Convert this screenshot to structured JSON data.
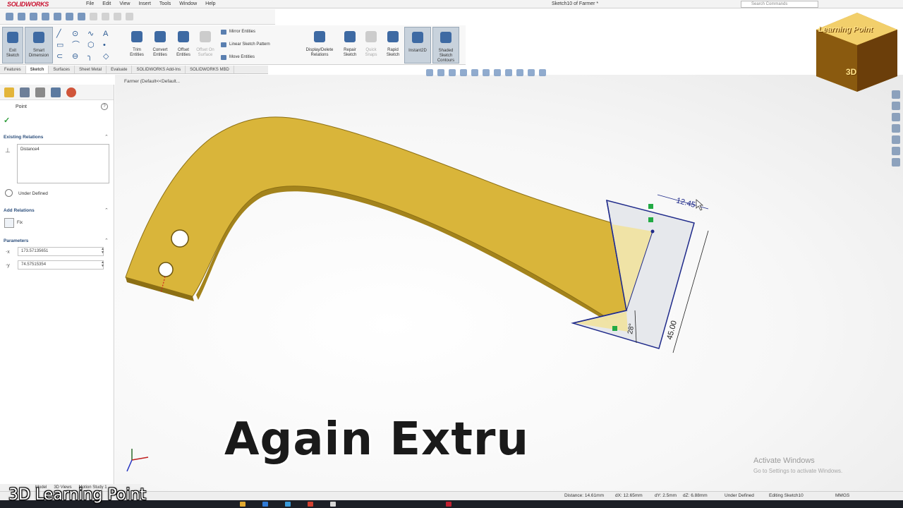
{
  "app": {
    "logo_text": "SOLIDWORKS",
    "document_title": "Sketch10 of Farmer *",
    "menu": [
      "File",
      "Edit",
      "View",
      "Insert",
      "Tools",
      "Window",
      "Help"
    ],
    "search_placeholder": "Search Commands"
  },
  "command_manager": {
    "exit_sketch": "Exit Sketch",
    "smart_dimension": "Smart Dimension",
    "trim_entities": "Trim Entities",
    "convert_entities": "Convert Entities",
    "offset_entities": "Offset Entities",
    "offset_on_surface": "Offset On Surface",
    "mirror_entities": "Mirror Entities",
    "linear_pattern": "Linear Sketch Pattern",
    "move_entities": "Move Entities",
    "display_relations": "Display/Delete Relations",
    "repair_sketch": "Repair Sketch",
    "quick_snaps": "Quick Snaps",
    "rapid_sketch": "Rapid Sketch",
    "instant2d": "Instant2D",
    "shaded_contours": "Shaded Sketch Contours"
  },
  "tabs": [
    "Features",
    "Sketch",
    "Surfaces",
    "Sheet Metal",
    "Evaluate",
    "SOLIDWORKS Add-Ins",
    "SOLIDWORKS MBD"
  ],
  "active_tab": "Sketch",
  "breadcrumb": "Farmer (Default<<Default...",
  "property_manager": {
    "title": "Point",
    "existing_relations_header": "Existing Relations",
    "relation_item": "Distance4",
    "status": "Under Defined",
    "add_relations_header": "Add Relations",
    "add_relation_item": "Fix",
    "parameters_header": "Parameters",
    "param_x": "173.57135651",
    "param_y": "74.57515354"
  },
  "dimensions": {
    "top": "12.45",
    "angle": "28°",
    "length": "45.00"
  },
  "caption": "Again Extru",
  "watermark": {
    "line1": "Learning Point",
    "line2": "3D"
  },
  "activate": {
    "line1": "Activate Windows",
    "line2": "Go to Settings to activate Windows."
  },
  "bottom_tabs": [
    "Model",
    "3D Views",
    "Motion Study 1"
  ],
  "status_bar": {
    "distance": "Distance: 14.61mm",
    "dx": "dX: 12.65mm",
    "dy": "dY: 2.5mm",
    "dz": "dZ: 6.88mm",
    "state": "Under Defined",
    "editing": "Editing Sketch10",
    "units": "MMGS"
  },
  "brand": "3D Learning Point",
  "colors": {
    "part_face": "#d9b53a",
    "part_edge": "#8c6f14",
    "sketch_line": "#1f2a8a",
    "region_fill": "#e3e6ea",
    "highlight_fill": "#f1e29a"
  }
}
